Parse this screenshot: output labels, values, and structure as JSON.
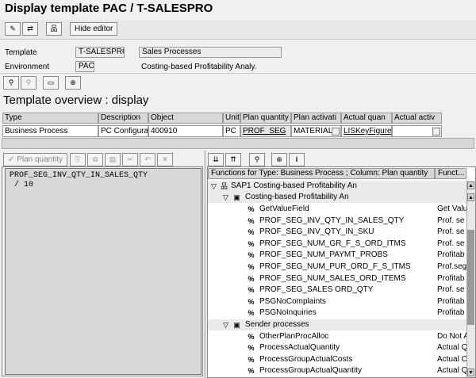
{
  "window": {
    "title": "Display template PAC / T-SALESPRO"
  },
  "toolbar": {
    "hide_editor": "Hide editor"
  },
  "header": {
    "template_label": "Template",
    "template_value": "T-SALESPRO",
    "template_desc": "Sales Processes",
    "environment_label": "Environment",
    "environment_value": "PAC",
    "environment_desc": "Costing-based Profitability Analy."
  },
  "overview": {
    "title": "Template overview : display",
    "columns": [
      "Type",
      "Description",
      "Object",
      "Unit",
      "Plan quantity",
      "Plan activati",
      "Actual quan",
      "Actual activ"
    ],
    "row": [
      "Business Process",
      "PC Configura",
      "400910",
      "PC",
      "PROF_SEG",
      "MATERIAL",
      "LISKeyFigure",
      ""
    ]
  },
  "editor_toolbar": {
    "plan_quantity": "Plan quantity"
  },
  "editor": {
    "text": "PROF_SEG_INV_QTY_IN_SALES_QTY\n / 10"
  },
  "functions": {
    "header_col1": "Functions for Type: Business Process ; Column: Plan quantity",
    "header_col2": "Funct...",
    "root": "SAP1 Costing-based Profitability An",
    "group1": "Costing-based Profitability An",
    "group1_items": [
      {
        "name": "GetValueField",
        "desc": "Get Valu"
      },
      {
        "name": "PROF_SEG_INV_QTY_IN_SALES_QTY",
        "desc": "Prof. se"
      },
      {
        "name": "PROF_SEG_INV_QTY_IN_SKU",
        "desc": "Prof. se"
      },
      {
        "name": "PROF_SEG_NUM_GR_F_S_ORD_ITMS",
        "desc": "Prof. se"
      },
      {
        "name": "PROF_SEG_NUM_PAYMT_PROBS",
        "desc": "Profitab"
      },
      {
        "name": "PROF_SEG_NUM_PUR_ORD_F_S_ITMS",
        "desc": "Prof.seg"
      },
      {
        "name": "PROF_SEG_NUM_SALES_ORD_ITEMS",
        "desc": "Profitab"
      },
      {
        "name": "PROF_SEG_SALES ORD_QTY",
        "desc": "Prof. se"
      },
      {
        "name": "PSGNoComplaints",
        "desc": "Profitab"
      },
      {
        "name": "PSGNoInquiries",
        "desc": "Profitab"
      }
    ],
    "group2": "Sender processes",
    "group2_items": [
      {
        "name": "OtherPlanProcAlloc",
        "desc": "Do Not A"
      },
      {
        "name": "ProcessActualQuantity",
        "desc": "Actual Q"
      },
      {
        "name": "ProcessGroupActualCosts",
        "desc": "Actual C"
      },
      {
        "name": "ProcessGroupActualQuantity",
        "desc": "Actual Q"
      }
    ]
  }
}
